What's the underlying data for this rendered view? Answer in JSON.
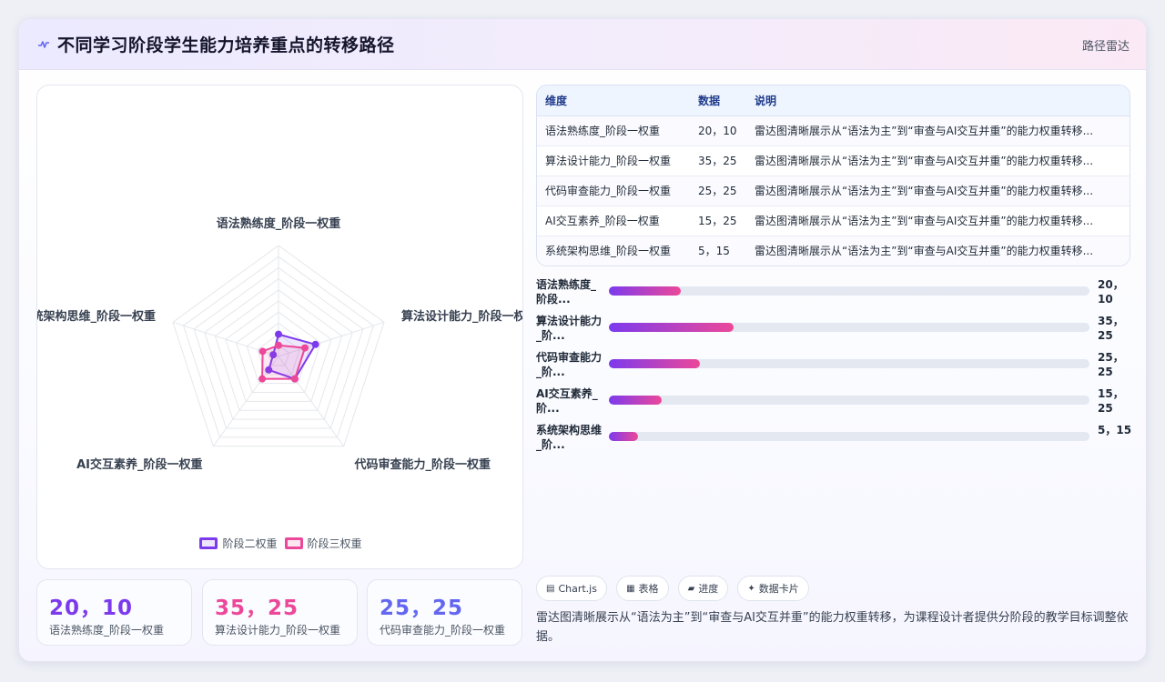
{
  "header": {
    "title": "不同学习阶段学生能力培养重点的转移路径",
    "tag": "路径雷达",
    "icon": "pulse-icon"
  },
  "chart_data": {
    "type": "radar",
    "axes": [
      "语法熟练度_阶段一权重",
      "算法设计能力_阶段一权重",
      "代码审查能力_阶段一权重",
      "AI交互素养_阶段一权重",
      "系统架构思维_阶段一权重"
    ],
    "series": [
      {
        "name": "阶段二权重",
        "values": [
          20,
          35,
          25,
          15,
          5
        ],
        "color": "#7c3aed"
      },
      {
        "name": "阶段三权重",
        "values": [
          10,
          25,
          25,
          25,
          15
        ],
        "color": "#ec4899"
      }
    ],
    "rmax": 100,
    "grid": true,
    "legend_position": "bottom"
  },
  "stats": [
    {
      "value": "20，10",
      "label": "语法熟练度_阶段一权重",
      "color": "#7c3aed"
    },
    {
      "value": "35，25",
      "label": "算法设计能力_阶段一权重",
      "color": "#ec4899"
    },
    {
      "value": "25，25",
      "label": "代码审查能力_阶段一权重",
      "color": "#6366f1"
    }
  ],
  "table": {
    "headers": [
      "维度",
      "数据",
      "说明"
    ],
    "rows": [
      [
        "语法熟练度_阶段一权重",
        "20，10",
        "雷达图清晰展示从“语法为主”到“审查与AI交互并重”的能力权重转移..."
      ],
      [
        "算法设计能力_阶段一权重",
        "35，25",
        "雷达图清晰展示从“语法为主”到“审查与AI交互并重”的能力权重转移..."
      ],
      [
        "代码审查能力_阶段一权重",
        "25，25",
        "雷达图清晰展示从“语法为主”到“审查与AI交互并重”的能力权重转移..."
      ],
      [
        "AI交互素养_阶段一权重",
        "15，25",
        "雷达图清晰展示从“语法为主”到“审查与AI交互并重”的能力权重转移..."
      ],
      [
        "系统架构思维_阶段一权重",
        "5，15",
        "雷达图清晰展示从“语法为主”到“审查与AI交互并重”的能力权重转移..."
      ]
    ]
  },
  "bars": [
    {
      "label": "语法熟练度_阶段...",
      "value": "20，10",
      "pct": 15
    },
    {
      "label": "算法设计能力_阶...",
      "value": "35，25",
      "pct": 26
    },
    {
      "label": "代码审查能力_阶...",
      "value": "25，25",
      "pct": 19
    },
    {
      "label": "AI交互素养_阶...",
      "value": "15，25",
      "pct": 11
    },
    {
      "label": "系统架构思维_阶...",
      "value": "5，15",
      "pct": 6
    }
  ],
  "chips": [
    {
      "icon": "▤",
      "label": "Chart.js"
    },
    {
      "icon": "▦",
      "label": "表格"
    },
    {
      "icon": "▰",
      "label": "进度"
    },
    {
      "icon": "✦",
      "label": "数据卡片"
    }
  ],
  "note": "雷达图清晰展示从“语法为主”到“审查与AI交互并重”的能力权重转移，为课程设计者提供分阶段的教学目标调整依据。"
}
